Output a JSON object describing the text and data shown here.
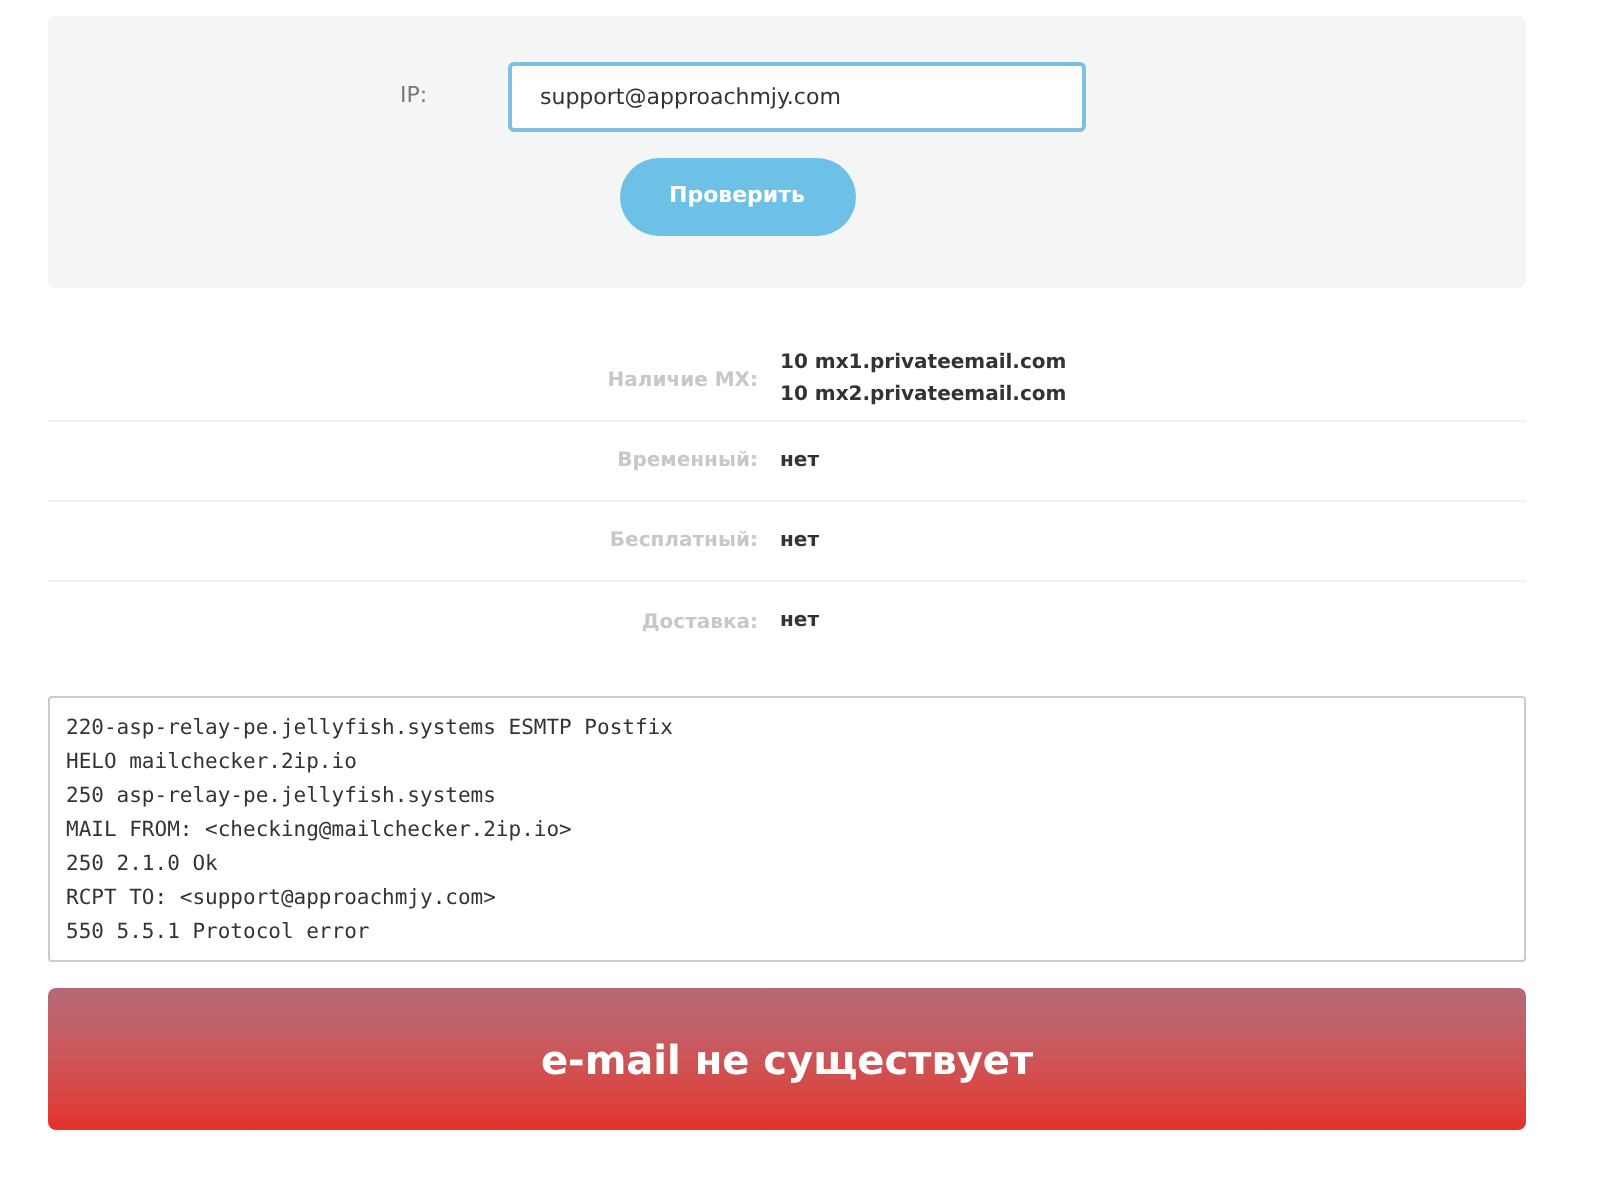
{
  "form": {
    "label": "IP:",
    "value": "support@approachmjy.com",
    "button": "Проверить"
  },
  "details": [
    {
      "label": "Наличие MX:",
      "values": [
        "10 mx1.privateemail.com",
        "10 mx2.privateemail.com"
      ]
    },
    {
      "label": "Временный:",
      "values": [
        "нет"
      ]
    },
    {
      "label": "Бесплатный:",
      "values": [
        "нет"
      ]
    },
    {
      "label": "Доставка:",
      "values": [
        "нет"
      ]
    }
  ],
  "log": [
    "220-asp-relay-pe.jellyfish.systems ESMTP Postfix",
    "HELO mailchecker.2ip.io",
    "250 asp-relay-pe.jellyfish.systems",
    "MAIL FROM: <checking@mailchecker.2ip.io>",
    "250 2.1.0 Ok",
    "RCPT TO: <support@approachmjy.com>",
    "550 5.5.1 Protocol error"
  ],
  "result": {
    "kind": "error",
    "text": "e-mail не существует"
  }
}
